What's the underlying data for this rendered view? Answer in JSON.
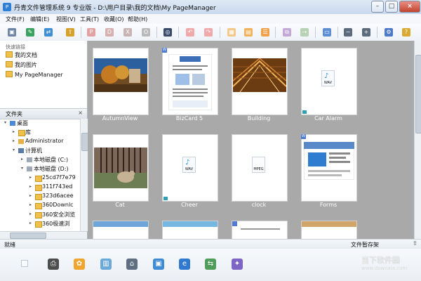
{
  "window": {
    "title": "丹青文件管理系统 9 专业版 - D:\\用户目录\\我的文档\\My PageManager",
    "controls": [
      "–",
      "□",
      "×"
    ]
  },
  "menu": [
    "文件(F)",
    "编辑(E)",
    "视图(V)",
    "工具(T)",
    "收藏(O)",
    "帮助(H)"
  ],
  "toolbar": {
    "icons": [
      "scanner-icon",
      "image-edit-icon",
      "convert-icon",
      "export-icon",
      "pdf-icon",
      "doc-icon",
      "xps-icon",
      "ocr-icon",
      "binoculars-icon",
      "arrow-left-icon",
      "arrow-right-icon",
      "view-large-icon",
      "view-medium-icon",
      "view-small-icon",
      "copy-icon",
      "move-icon",
      "screen-icon",
      "zoom-out-icon",
      "zoom-in-icon",
      "settings-icon",
      "help-icon"
    ]
  },
  "sidebar": {
    "quick_links_caption": "快速链接",
    "quick_links": [
      "我的文档",
      "我的图片",
      "My PageManager"
    ],
    "folders_title": "文件夹",
    "close_symbol": "×",
    "tree": [
      {
        "label": "桌面",
        "expanded": true
      },
      {
        "label": "库",
        "expanded": false
      },
      {
        "label": "Administrator",
        "expanded": false
      },
      {
        "label": "计算机",
        "expanded": true
      },
      {
        "label": "本地磁盘 (C:)",
        "expanded": false
      },
      {
        "label": "本地磁盘 (D:)",
        "expanded": true
      },
      {
        "label": "25cd7f7e79",
        "expanded": false
      },
      {
        "label": "311f743ed",
        "expanded": false
      },
      {
        "label": "323d6acee",
        "expanded": false
      },
      {
        "label": "360Downlc",
        "expanded": false
      },
      {
        "label": "360安全浏览",
        "expanded": false
      },
      {
        "label": "360极速浏",
        "expanded": false
      }
    ]
  },
  "main": {
    "items": [
      {
        "label": "AutumnView",
        "type": "image",
        "badge": ""
      },
      {
        "label": "BizCard 5",
        "type": "document",
        "badge": "W"
      },
      {
        "label": "Building",
        "type": "image",
        "badge": ""
      },
      {
        "label": "Car Alarm",
        "type": "audio",
        "badge": "",
        "wav_text": "WAV"
      },
      {
        "label": "Cat",
        "type": "image",
        "badge": ""
      },
      {
        "label": "Cheer",
        "type": "audio",
        "badge": "",
        "wav_text": "WAV"
      },
      {
        "label": "clock",
        "type": "audio",
        "badge": "",
        "wav_text": "MPEG"
      },
      {
        "label": "Forms",
        "type": "document",
        "badge": "W"
      }
    ]
  },
  "status": {
    "left": "就绪",
    "right_panel": "文件暂存架",
    "right_arrow": "⇧"
  },
  "dock": {
    "icons": [
      "blank-button",
      "printer-icon",
      "paint-icon",
      "book-icon",
      "fax-icon",
      "gallery-icon",
      "browser-icon",
      "share-icon",
      "tools-icon"
    ],
    "watermark_cn": "当下软件园",
    "watermark_url": "www.downxia.com"
  }
}
